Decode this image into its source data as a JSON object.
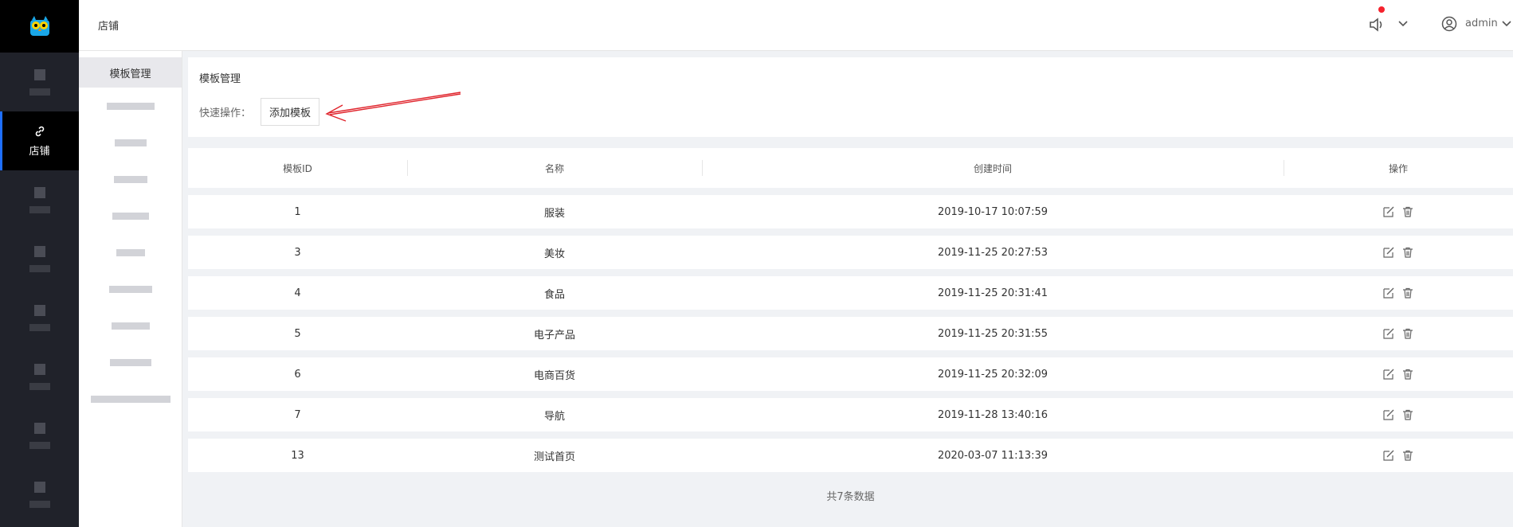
{
  "header": {
    "breadcrumb": "店铺",
    "username": "admin"
  },
  "nav": {
    "active_label": "店铺"
  },
  "subnav": {
    "active_label": "模板管理"
  },
  "panel": {
    "title": "模板管理",
    "quick_label": "快速操作：",
    "add_button": "添加模板"
  },
  "table": {
    "columns": [
      "模板ID",
      "名称",
      "创建时间",
      "操作"
    ],
    "rows": [
      {
        "id": "1",
        "name": "服装",
        "created": "2019-10-17 10:07:59"
      },
      {
        "id": "3",
        "name": "美妆",
        "created": "2019-11-25 20:27:53"
      },
      {
        "id": "4",
        "name": "食品",
        "created": "2019-11-25 20:31:41"
      },
      {
        "id": "5",
        "name": "电子产品",
        "created": "2019-11-25 20:31:55"
      },
      {
        "id": "6",
        "name": "电商百货",
        "created": "2019-11-25 20:32:09"
      },
      {
        "id": "7",
        "name": "导航",
        "created": "2019-11-28 13:40:16"
      },
      {
        "id": "13",
        "name": "测试首页",
        "created": "2020-03-07 11:13:39"
      }
    ],
    "footer": "共7条数据"
  },
  "colors": {
    "nav_bg": "#20222a",
    "accent": "#1e6fff",
    "annotation": "#e0242c",
    "notify_dot": "#f5222d"
  }
}
